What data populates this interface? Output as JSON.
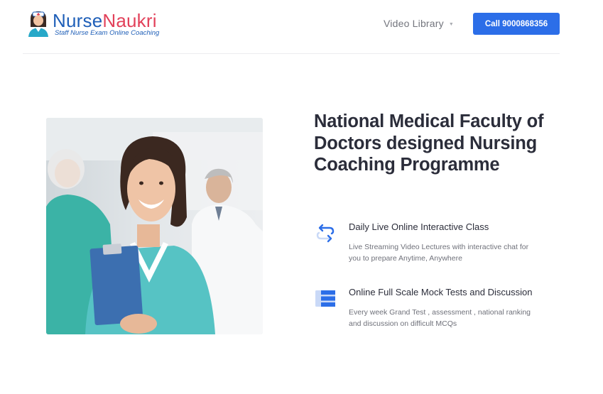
{
  "header": {
    "logo": {
      "name_part1": "Nurse",
      "name_part2": "Naukri",
      "tagline": "Staff Nurse Exam Online Coaching"
    },
    "nav": {
      "video_library": "Video Library",
      "video_library_icon": "chevron-down-icon"
    },
    "call_button": "Call 9000868356"
  },
  "hero": {
    "image_icon": "nurse-photo",
    "headline": "National Medical Faculty of Doctors designed Nursing Coaching Programme",
    "features": [
      {
        "icon": "live-stream-arrows-icon",
        "title": "Daily Live Online Interactive Class",
        "description": "Live Streaming Video Lectures with interactive chat for you to prepare Anytime, Anywhere"
      },
      {
        "icon": "list-icon",
        "title": "Online Full Scale Mock Tests and Discussion",
        "description": "Every week Grand Test , assessment , national ranking and discussion on difficult MCQs"
      }
    ]
  },
  "colors": {
    "brand_blue": "#2c6ee8",
    "logo_blue": "#1f5fb8",
    "logo_pink": "#e2415a",
    "text_dark": "#2b2d3a"
  }
}
